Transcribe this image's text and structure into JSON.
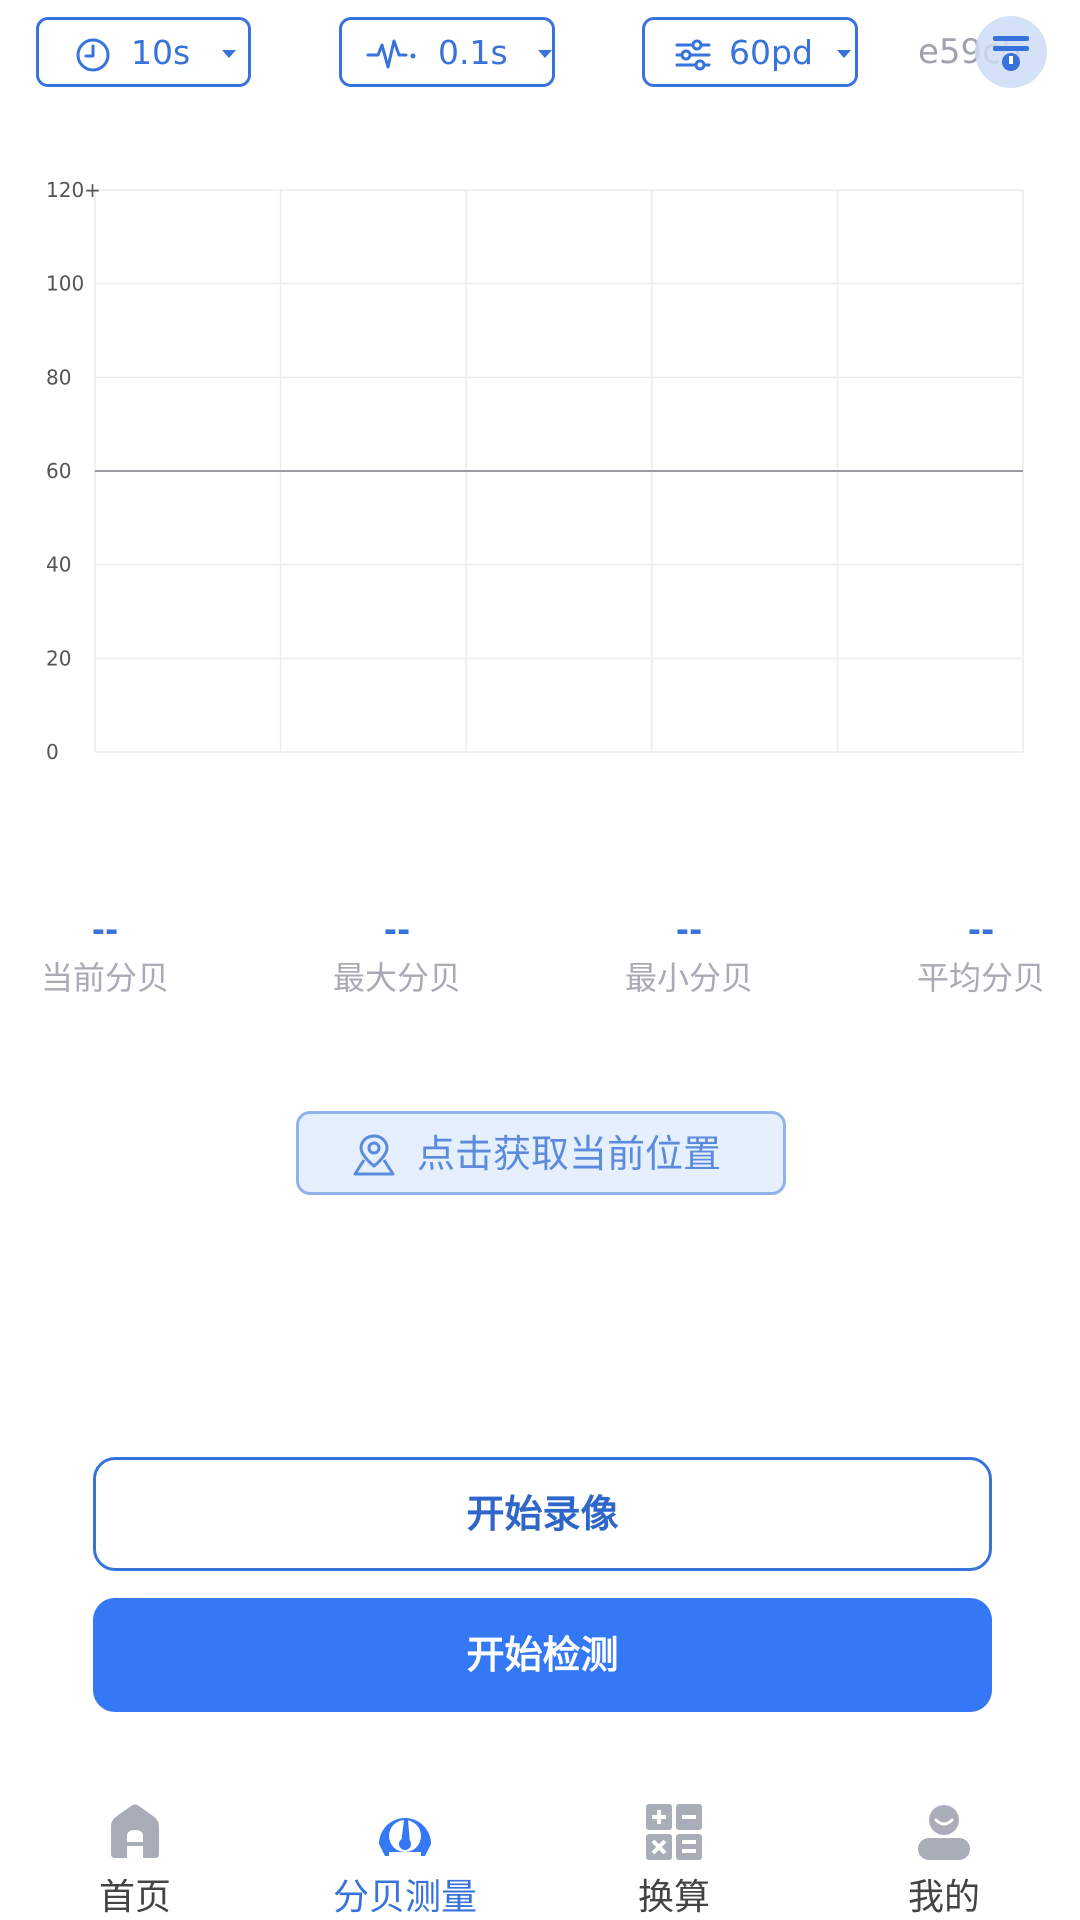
{
  "toolbar": {
    "duration": {
      "value": "10s",
      "icon": "clock-icon"
    },
    "interval": {
      "value": "0.1s",
      "icon": "waveform-icon"
    },
    "threshold": {
      "value": "60pd",
      "icon": "sliders-icon"
    },
    "device_id": "e59c5"
  },
  "chart_data": {
    "type": "line",
    "title": "",
    "xlabel": "",
    "ylabel": "",
    "ylim": [
      0,
      120
    ],
    "y_ticks": [
      "0",
      "20",
      "40",
      "60",
      "80",
      "100",
      "120+"
    ],
    "y_tick_values": [
      0,
      20,
      40,
      60,
      80,
      100,
      120
    ],
    "reference_line": 60,
    "grid": true,
    "series": []
  },
  "stats": {
    "current": {
      "value": "--",
      "label": "当前分贝"
    },
    "max": {
      "value": "--",
      "label": "最大分贝"
    },
    "min": {
      "value": "--",
      "label": "最小分贝"
    },
    "avg": {
      "value": "--",
      "label": "平均分贝"
    }
  },
  "location": {
    "label": "点击获取当前位置",
    "icon": "map-pin-icon"
  },
  "actions": {
    "record_label": "开始录像",
    "detect_label": "开始检测"
  },
  "tabs": [
    {
      "label": "首页",
      "icon": "home-icon",
      "active": false
    },
    {
      "label": "分贝测量",
      "icon": "speedometer-icon",
      "active": true
    },
    {
      "label": "换算",
      "icon": "calculator-icon",
      "active": false
    },
    {
      "label": "我的",
      "icon": "user-icon",
      "active": false
    }
  ],
  "colors": {
    "accent": "#3478f6",
    "accent_dark": "#3773db",
    "muted_text": "#a7abb3",
    "tab_inactive_icon": "#a8adb8"
  }
}
